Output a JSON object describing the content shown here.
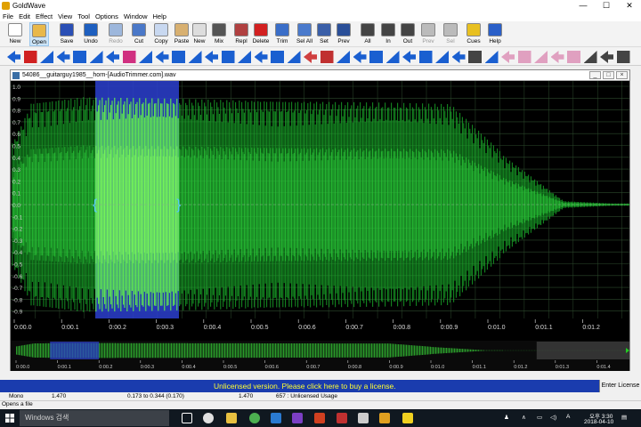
{
  "app": {
    "title": "GoldWave"
  },
  "window_controls": {
    "minimize": "—",
    "maximize": "☐",
    "close": "✕"
  },
  "menu": [
    "File",
    "Edit",
    "Effect",
    "View",
    "Tool",
    "Options",
    "Window",
    "Help"
  ],
  "toolbar": [
    {
      "label": "New",
      "color": "#ffffff",
      "icon": "new-file-icon",
      "enabled": true
    },
    {
      "label": "Open",
      "color": "#e8b84a",
      "icon": "open-folder-icon",
      "enabled": true
    },
    {
      "label": "Save",
      "color": "#2a4fb5",
      "icon": "save-disk-icon",
      "enabled": true
    },
    {
      "label": "Undo",
      "color": "#1e5fbf",
      "icon": "undo-icon",
      "enabled": true
    },
    {
      "label": "Redo",
      "color": "#9db7dc",
      "icon": "redo-icon",
      "enabled": false
    },
    {
      "label": "Cut",
      "color": "#4a78c8",
      "icon": "scissors-icon",
      "enabled": true
    },
    {
      "label": "Copy",
      "color": "#c8d8f0",
      "icon": "copy-icon",
      "enabled": true
    },
    {
      "label": "Paste",
      "color": "#d8b070",
      "icon": "paste-icon",
      "enabled": true
    },
    {
      "label": "New",
      "color": "#dddddd",
      "icon": "new-icon",
      "enabled": true
    },
    {
      "label": "Mix",
      "color": "#555555",
      "icon": "mix-icon",
      "enabled": true
    },
    {
      "label": "Repl",
      "color": "#b04040",
      "icon": "replace-icon",
      "enabled": true
    },
    {
      "label": "Delete",
      "color": "#d22020",
      "icon": "delete-icon",
      "enabled": true
    },
    {
      "label": "Trim",
      "color": "#3a6ec8",
      "icon": "trim-icon",
      "enabled": true
    },
    {
      "label": "Sel All",
      "color": "#4a7acc",
      "icon": "select-all-icon",
      "enabled": true
    },
    {
      "label": "Set",
      "color": "#3a5fa8",
      "icon": "set-icon",
      "enabled": true
    },
    {
      "label": "Prev",
      "color": "#2a4f98",
      "icon": "previous-icon",
      "enabled": true
    },
    {
      "label": "All",
      "color": "#444444",
      "icon": "zoom-all-icon",
      "enabled": true
    },
    {
      "label": "In",
      "color": "#444444",
      "icon": "zoom-in-icon",
      "enabled": true
    },
    {
      "label": "Out",
      "color": "#444444",
      "icon": "zoom-out-icon",
      "enabled": true
    },
    {
      "label": "Prev",
      "color": "#bbbbbb",
      "icon": "zoom-previous-icon",
      "enabled": false
    },
    {
      "label": "Sel",
      "color": "#bbbbbb",
      "icon": "zoom-selection-icon",
      "enabled": false
    },
    {
      "label": "Cues",
      "color": "#e8c020",
      "icon": "cues-icon",
      "enabled": true
    },
    {
      "label": "Help",
      "color": "#2a5fc8",
      "icon": "help-icon",
      "enabled": true
    }
  ],
  "document": {
    "title": "54086__guitarguy1985__horn-[AudioTrimmer.com].wav",
    "amplitude_labels": [
      "1.0",
      "0.9",
      "0.8",
      "0.7",
      "0.6",
      "0.5",
      "0.4",
      "0.3",
      "0.2",
      "0.1",
      "0.0",
      "-0.1",
      "-0.2",
      "-0.3",
      "-0.4",
      "-0.5",
      "-0.6",
      "-0.7",
      "-0.8",
      "-0.9"
    ],
    "time_labels": [
      "0:00.0",
      "0:00.1",
      "0:00.2",
      "0:00.3",
      "0:00.4",
      "0:00.5",
      "0:00.6",
      "0:00.7",
      "0:00.8",
      "0:00.9",
      "0:01.0",
      "0:01.1",
      "0:01.2"
    ],
    "overview_labels": [
      "0:00.0",
      "0:00.1",
      "0:00.2",
      "0:00.3",
      "0:00.4",
      "0:00.5",
      "0:00.6",
      "0:00.7",
      "0:00.8",
      "0:00.9",
      "0:01.0",
      "0:01.1",
      "0:01.2",
      "0:01.3",
      "0:01.4"
    ],
    "duration": 1.47,
    "selection_start": 0.173,
    "selection_end": 0.344
  },
  "status": {
    "unlicensed": "Unlicensed version. Please click here to buy a license.",
    "enter_license": "Enter License",
    "channel": "Mono",
    "length": "1.470",
    "selection": "0.173 to 0.344 (0.170)",
    "position": "1.470",
    "usage": "657 : Unlicensed Usage",
    "hint": "Opens a file"
  },
  "taskbar": {
    "search": "Windows 검색",
    "clock_time": "오후 3:30",
    "clock_date": "2018-04-10"
  },
  "colors": {
    "waveform": "#1aa82a",
    "waveform_selected": "#66ff44",
    "selection": "#2c3fd0",
    "grid": "#2d4a2d",
    "status": "#1a3cae"
  }
}
